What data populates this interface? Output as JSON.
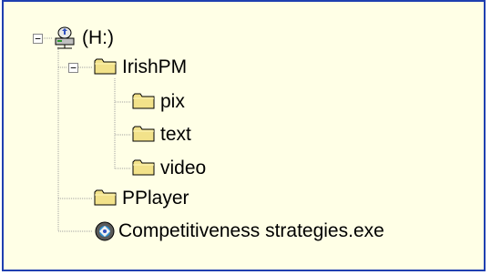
{
  "tree": {
    "nodes": [
      {
        "name": "drive-h",
        "label": "(H:)",
        "icon": "network-drive-icon",
        "expanded": true
      },
      {
        "name": "folder-irishpm",
        "label": "IrishPM",
        "icon": "folder-icon",
        "expanded": true
      },
      {
        "name": "folder-pix",
        "label": "pix",
        "icon": "folder-icon"
      },
      {
        "name": "folder-text",
        "label": "text",
        "icon": "folder-icon"
      },
      {
        "name": "folder-video",
        "label": "video",
        "icon": "folder-icon"
      },
      {
        "name": "folder-pplayer",
        "label": "PPlayer",
        "icon": "folder-icon"
      },
      {
        "name": "file-exe",
        "label": "Competitiveness strategies.exe",
        "icon": "exe-icon"
      }
    ],
    "expander_glyph": "−"
  },
  "colors": {
    "panel_bg": "#ffffe6",
    "border": "#1f3fb0",
    "folder": "#f2e28a",
    "tree_line": "#a0a0a0"
  }
}
